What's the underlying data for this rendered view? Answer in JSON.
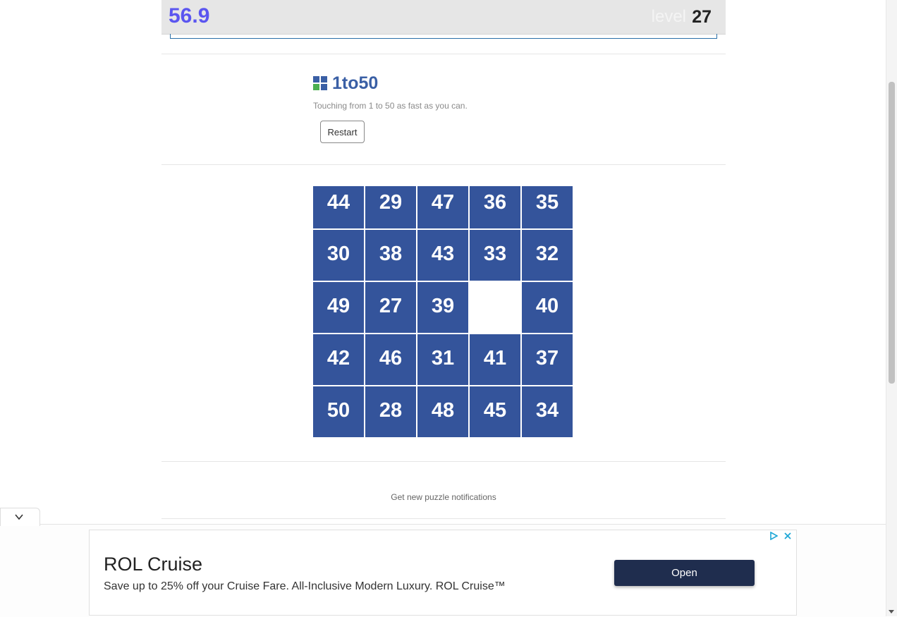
{
  "header": {
    "timer": "56.9",
    "level_label": "level",
    "level_number": "27"
  },
  "game": {
    "title": "1to50",
    "subtitle": "Touching from 1 to 50 as fast as you can.",
    "restart_label": "Restart",
    "logo_colors": [
      "#3a5fa5",
      "#3a5fa5",
      "#4caf50",
      "#3a5fa5"
    ],
    "tile_color": "#34549b",
    "tiles": [
      "44",
      "29",
      "47",
      "36",
      "35",
      "30",
      "38",
      "43",
      "33",
      "32",
      "49",
      "27",
      "39",
      "",
      "40",
      "42",
      "46",
      "31",
      "41",
      "37",
      "50",
      "28",
      "48",
      "45",
      "34"
    ]
  },
  "footer": {
    "notifications": "Get new puzzle notifications"
  },
  "ad": {
    "title": "ROL Cruise",
    "description": "Save up to 25% off your Cruise Fare. All-Inclusive Modern Luxury. ROL Cruise™",
    "button": "Open",
    "icons": [
      "adchoices-icon",
      "close-icon"
    ],
    "accent": "#1f2d4e"
  }
}
